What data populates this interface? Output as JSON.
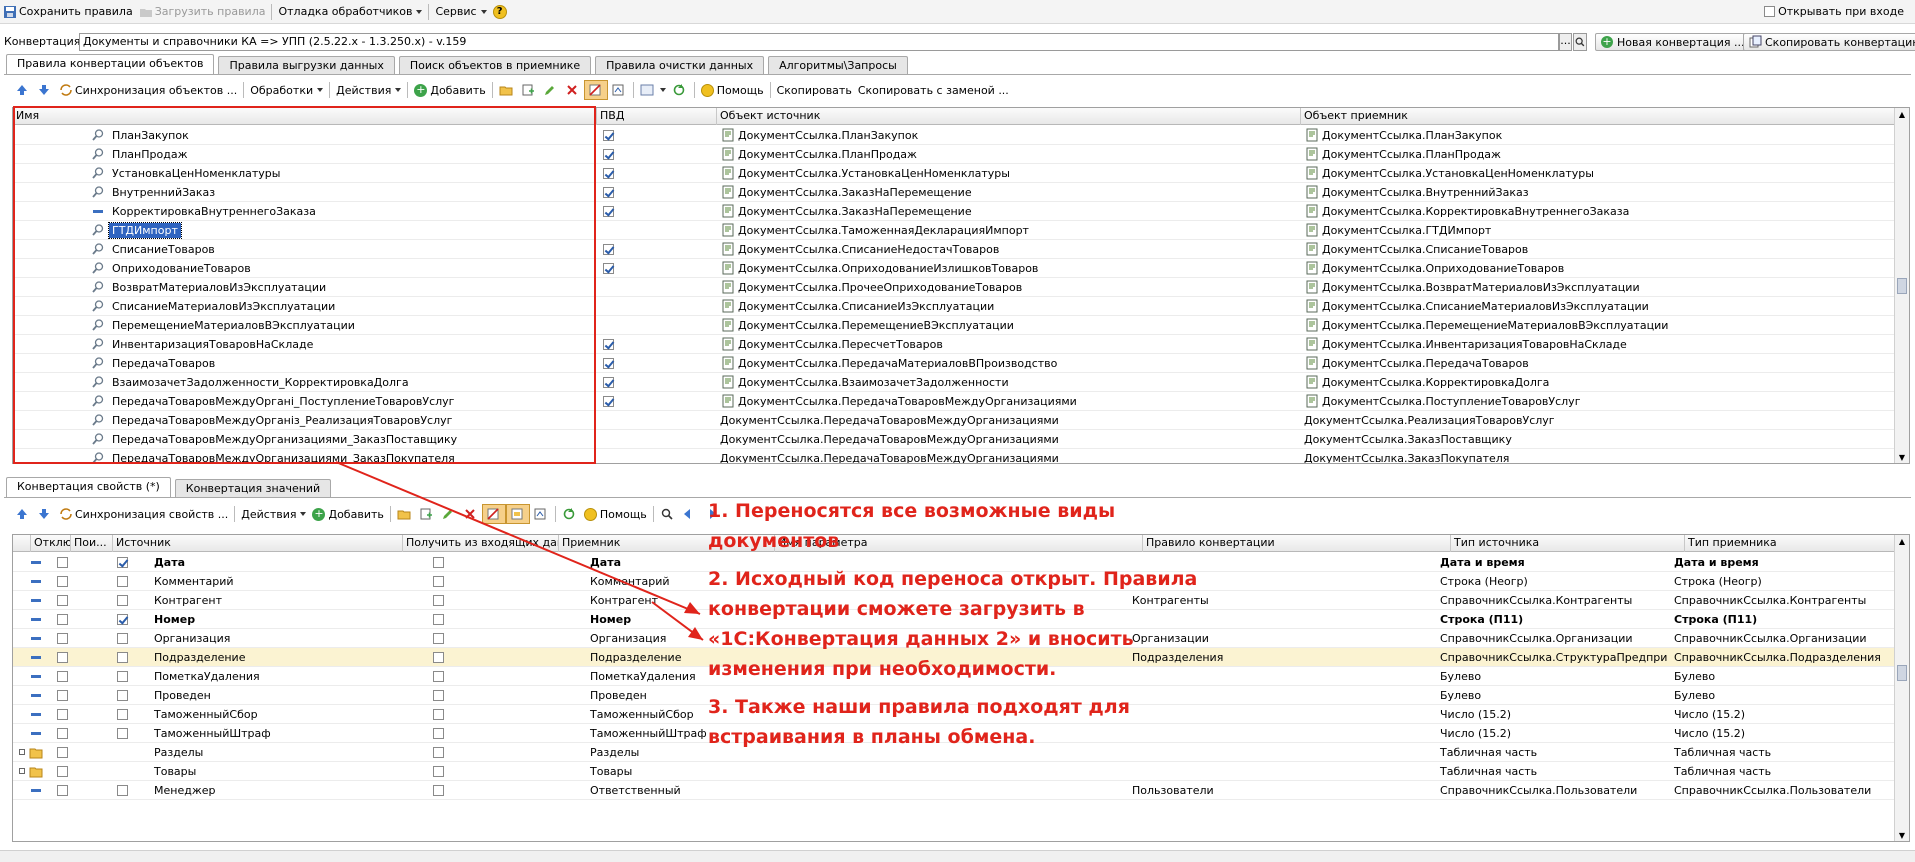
{
  "top_toolbar": {
    "save": "Сохранить правила",
    "load": "Загрузить правила",
    "debug": "Отладка обработчиков",
    "service": "Сервис",
    "help": "?",
    "open_on_start": "Открывать при входе"
  },
  "conversion": {
    "label": "Конвертация:",
    "value": "Документы и справочники КА => УПП (2.5.22.x - 1.3.250.x) - v.159",
    "dots": "...",
    "new_button": "Новая конвертация ...",
    "copy_button": "Скопировать конвертацию"
  },
  "main_tabs": [
    "Правила конвертации объектов",
    "Правила выгрузки данных",
    "Поиск объектов в приемнике",
    "Правила очистки данных",
    "Алгоритмы\\Запросы"
  ],
  "rules_toolbar": {
    "sync": "Синхронизация объектов ...",
    "processing": "Обработки",
    "actions": "Действия",
    "add": "Добавить",
    "help": "Помощь",
    "copy": "Скопировать",
    "copy_replace": "Скопировать с заменой ..."
  },
  "rules_grid": {
    "columns": [
      "Имя",
      "ПВД",
      "Объект источник",
      "Объект приемник"
    ],
    "rows": [
      {
        "name": "ПланЗакупок",
        "pvd": true,
        "src": "ДокументСсылка.ПланЗакупок",
        "dst": "ДокументСсылка.ПланЗакупок",
        "icon": "search"
      },
      {
        "name": "ПланПродаж",
        "pvd": true,
        "src": "ДокументСсылка.ПланПродаж",
        "dst": "ДокументСсылка.ПланПродаж",
        "icon": "search"
      },
      {
        "name": "УстановкаЦенНоменклатуры",
        "pvd": true,
        "src": "ДокументСсылка.УстановкаЦенНоменклатуры",
        "dst": "ДокументСсылка.УстановкаЦенНоменклатуры",
        "icon": "search"
      },
      {
        "name": "ВнутреннийЗаказ",
        "pvd": true,
        "src": "ДокументСсылка.ЗаказНаПеремещение",
        "dst": "ДокументСсылка.ВнутреннийЗаказ",
        "icon": "search"
      },
      {
        "name": "КорректировкаВнутреннегоЗаказа",
        "pvd": true,
        "src": "ДокументСсылка.ЗаказНаПеремещение",
        "dst": "ДокументСсылка.КорректировкаВнутреннегоЗаказа",
        "icon": "dash"
      },
      {
        "name": "ГТДИмпорт",
        "pvd": false,
        "src": "ДокументСсылка.ТаможеннаяДекларацияИмпорт",
        "dst": "ДокументСсылка.ГТДИмпорт",
        "icon": "search",
        "selected": true
      },
      {
        "name": "СписаниеТоваров",
        "pvd": true,
        "src": "ДокументСсылка.СписаниеНедостачТоваров",
        "dst": "ДокументСсылка.СписаниеТоваров",
        "icon": "search"
      },
      {
        "name": "ОприходованиеТоваров",
        "pvd": true,
        "src": "ДокументСсылка.ОприходованиеИзлишковТоваров",
        "dst": "ДокументСсылка.ОприходованиеТоваров",
        "icon": "search"
      },
      {
        "name": "ВозвратМатериаловИзЭксплуатации",
        "pvd": false,
        "src": "ДокументСсылка.ПрочееОприходованиеТоваров",
        "dst": "ДокументСсылка.ВозвратМатериаловИзЭксплуатации",
        "icon": "search"
      },
      {
        "name": "СписаниеМатериаловИзЭксплуатации",
        "pvd": false,
        "src": "ДокументСсылка.СписаниеИзЭксплуатации",
        "dst": "ДокументСсылка.СписаниеМатериаловИзЭксплуатации",
        "icon": "search"
      },
      {
        "name": "ПеремещениеМатериаловВЭксплуатации",
        "pvd": false,
        "src": "ДокументСсылка.ПеремещениеВЭксплуатации",
        "dst": "ДокументСсылка.ПеремещениеМатериаловВЭксплуатации",
        "icon": "search"
      },
      {
        "name": "ИнвентаризацияТоваровНаСкладе",
        "pvd": true,
        "src": "ДокументСсылка.ПересчетТоваров",
        "dst": "ДокументСсылка.ИнвентаризацияТоваровНаСкладе",
        "icon": "search"
      },
      {
        "name": "ПередачаТоваров",
        "pvd": true,
        "src": "ДокументСсылка.ПередачаМатериаловВПроизводство",
        "dst": "ДокументСсылка.ПередачаТоваров",
        "icon": "search"
      },
      {
        "name": "ВзаимозачетЗадолженности_КорректировкаДолга",
        "pvd": true,
        "src": "ДокументСсылка.ВзаимозачетЗадолженности",
        "dst": "ДокументСсылка.КорректировкаДолга",
        "icon": "search"
      },
      {
        "name": "ПередачаТоваровМеждуОрганi_ПоступлениеТоваровУслуг",
        "pvd": true,
        "src": "ДокументСсылка.ПередачаТоваровМеждуОрганизациями",
        "dst": "ДокументСсылка.ПоступлениеТоваровУслуг",
        "icon": "search"
      },
      {
        "name": "ПередачаТоваровМеждуОрганiз_РеализацияТоваровУслуг",
        "pvd": false,
        "src": "ДокументСсылка.ПередачаТоваровМеждуОрганизациями",
        "dst": "ДокументСсылка.РеализацияТоваровУслуг",
        "icon": "search",
        "noicon": true
      },
      {
        "name": "ПередачаТоваровМеждуОрганизациями_ЗаказПоставщику",
        "pvd": false,
        "src": "ДокументСсылка.ПередачаТоваровМеждуОрганизациями",
        "dst": "ДокументСсылка.ЗаказПоставщику",
        "icon": "search",
        "noicon": true
      },
      {
        "name": "ПередачаТоваровМеждуОрганизациями_ЗаказПокупателя",
        "pvd": false,
        "src": "ДокументСсылка.ПередачаТоваровМеждуОрганизациями",
        "dst": "ДокументСсылка.ЗаказПокупателя",
        "icon": "search",
        "noicon": true
      }
    ]
  },
  "lower_tabs": [
    "Конвертация свойств (*)",
    "Конвертация значений"
  ],
  "props_toolbar": {
    "sync": "Синхронизация свойств ...",
    "actions": "Действия",
    "add": "Добавить",
    "help": "Помощь"
  },
  "props_grid": {
    "columns": [
      "Отключ...",
      "Пои...",
      "Источник",
      "Получить из входящих данн...",
      "Приемник",
      "Имя параметра",
      "Правило конвертации",
      "Тип источника",
      "Тип приемника"
    ],
    "rows": [
      {
        "kind": "dash",
        "off": false,
        "search": true,
        "src": "Дата",
        "get": false,
        "dst": "Дата",
        "param": "",
        "rule": "",
        "tsrc": "Дата и время",
        "tdst": "Дата и время",
        "bold": true
      },
      {
        "kind": "dash",
        "off": false,
        "search": false,
        "src": "Комментарий",
        "get": false,
        "dst": "Комментарий",
        "param": "",
        "rule": "",
        "tsrc": "Строка (Неогр)",
        "tdst": "Строка (Неогр)"
      },
      {
        "kind": "dash",
        "off": false,
        "search": false,
        "src": "Контрагент",
        "get": false,
        "dst": "Контрагент",
        "param": "",
        "rule": "Контрагенты",
        "tsrc": "СправочникСсылка.Контрагенты",
        "tdst": "СправочникСсылка.Контрагенты"
      },
      {
        "kind": "dash",
        "off": false,
        "search": true,
        "src": "Номер",
        "get": false,
        "dst": "Номер",
        "param": "",
        "rule": "",
        "tsrc": "Строка (П11)",
        "tdst": "Строка (П11)",
        "bold": true
      },
      {
        "kind": "dash",
        "off": false,
        "search": false,
        "src": "Организация",
        "get": false,
        "dst": "Организация",
        "param": "",
        "rule": "Организации",
        "tsrc": "СправочникСсылка.Организации",
        "tdst": "СправочникСсылка.Организации"
      },
      {
        "kind": "dash",
        "off": false,
        "search": false,
        "src": "Подразделение",
        "get": false,
        "dst": "Подразделение",
        "param": "",
        "rule": "Подразделения",
        "tsrc": "СправочникСсылка.СтруктураПредприятия",
        "tdst": "СправочникСсылка.Подразделения",
        "hl": true
      },
      {
        "kind": "dash",
        "off": false,
        "search": false,
        "src": "ПометкаУдаления",
        "get": false,
        "dst": "ПометкаУдаления",
        "param": "",
        "rule": "",
        "tsrc": "Булево",
        "tdst": "Булево"
      },
      {
        "kind": "dash",
        "off": false,
        "search": false,
        "src": "Проведен",
        "get": false,
        "dst": "Проведен",
        "param": "",
        "rule": "",
        "tsrc": "Булево",
        "tdst": "Булево"
      },
      {
        "kind": "dash",
        "off": false,
        "search": false,
        "src": "ТаможенныйСбор",
        "get": false,
        "dst": "ТаможенныйСбор",
        "param": "",
        "rule": "",
        "tsrc": "Число (15.2)",
        "tdst": "Число (15.2)"
      },
      {
        "kind": "dash",
        "off": false,
        "search": false,
        "src": "ТаможенныйШтраф",
        "get": false,
        "dst": "ТаможенныйШтраф",
        "param": "",
        "rule": "",
        "tsrc": "Число (15.2)",
        "tdst": "Число (15.2)"
      },
      {
        "kind": "folder",
        "off": false,
        "search": null,
        "src": "Разделы",
        "get": false,
        "dst": "Разделы",
        "param": "",
        "rule": "",
        "tsrc": "Табличная часть",
        "tdst": "Табличная часть"
      },
      {
        "kind": "folder",
        "off": false,
        "search": null,
        "src": "Товары",
        "get": false,
        "dst": "Товары",
        "param": "",
        "rule": "",
        "tsrc": "Табличная часть",
        "tdst": "Табличная часть"
      },
      {
        "kind": "dash",
        "off": false,
        "search": false,
        "src": "Менеджер",
        "get": false,
        "dst": "Ответственный",
        "param": "",
        "rule": "Пользователи",
        "tsrc": "СправочникСсылка.Пользователи",
        "tdst": "СправочникСсылка.Пользователи"
      }
    ]
  },
  "annotation": {
    "p1a": "1. Переносятся все возможные виды",
    "p1b": "документов",
    "p2a": "2. Исходный код переноса открыт. Правила",
    "p2b": "конвертации сможете загрузить в",
    "p2c": "«1С:Конвертация данных 2» и вносить",
    "p2d": "изменения при необходимости.",
    "p3a": "3. Также наши правила подходят для",
    "p3b": "встраивания в планы обмена."
  },
  "colors": {
    "annotation": "#e0241b",
    "selection": "#2f64c0",
    "highlight_row": "#fbf3d2"
  }
}
